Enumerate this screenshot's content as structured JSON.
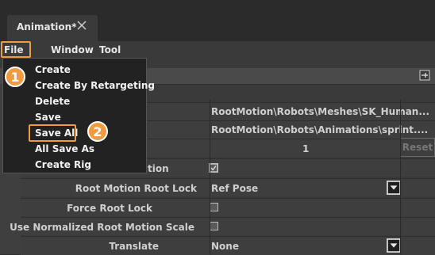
{
  "tab": {
    "title": "Animation*"
  },
  "menubar": {
    "file": "File",
    "window": "Window",
    "tool": "Tool"
  },
  "file_menu": {
    "items": [
      "Create",
      "Create By Retargeting",
      "Delete",
      "Save",
      "Save All",
      "All Save As",
      "Create Rig"
    ]
  },
  "badges": {
    "one": "1",
    "two": "2"
  },
  "properties": {
    "mesh_path": "RootMotion\\Robots\\Meshes\\SK_Human...",
    "animation_path": "RootMotion\\Robots\\Animations\\sprint....",
    "count_value": "1",
    "reset_label": "Reset",
    "partial_label": "tion",
    "root_lock_label": "Root Motion Root Lock",
    "root_lock_value": "Ref Pose",
    "force_root_lock_label": "Force Root Lock",
    "use_scale_label": "Use Normalized Root Motion Scale",
    "translate_label": "Translate",
    "translate_value": "None"
  },
  "colors": {
    "accent": "#f29a3e",
    "panel": "#3a3a3a",
    "menu_bg": "#222222"
  }
}
